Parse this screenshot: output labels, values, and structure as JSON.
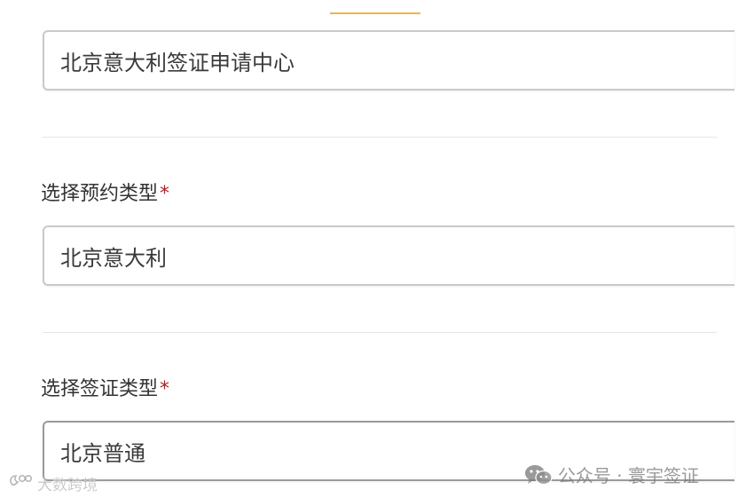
{
  "form": {
    "center_field": {
      "value": "北京意大利签证申请中心"
    },
    "appointment_type": {
      "label": "选择预约类型",
      "required_mark": "*",
      "value": "北京意大利"
    },
    "visa_type": {
      "label": "选择签证类型",
      "required_mark": "*",
      "value": "北京普通"
    }
  },
  "colors": {
    "accent_bar": "#f0b44a",
    "required": "#a8262a",
    "border": "#c9c9c9"
  },
  "watermarks": {
    "left_text": "大数跨境",
    "left_logo_icon": "weibo-like-logo-icon",
    "right_icon": "wechat-icon",
    "right_text": "公众号 · 寰宇签证"
  }
}
